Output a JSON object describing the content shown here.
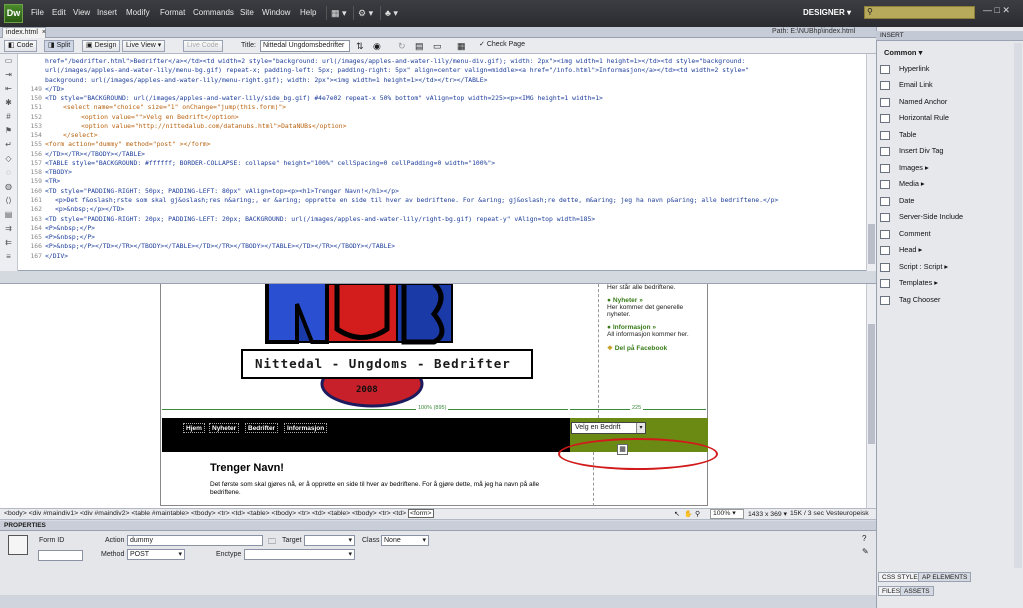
{
  "app": {
    "logo": "Dw",
    "workspace": "DESIGNER",
    "window_controls": "—  □  ✕"
  },
  "menu": [
    "File",
    "Edit",
    "View",
    "Insert",
    "Modify",
    "Format",
    "Commands",
    "Site",
    "Window",
    "Help"
  ],
  "document": {
    "tab": "index.html",
    "path_label": "Path:",
    "path": "E:\\NUBhp\\index.html"
  },
  "toolbar": {
    "code": "Code",
    "split": "Split",
    "design": "Design",
    "live_view": "Live View",
    "live_code": "Live Code",
    "title_label": "Title:",
    "title_value": "Nittedal Ungdomsbedrifter",
    "check_page": "Check Page"
  },
  "code": {
    "line_numbers": [
      "",
      "",
      "",
      "149",
      "150",
      "151",
      "152",
      "153",
      "154",
      "155",
      "156",
      "157",
      "158",
      "159",
      "160",
      "161",
      "162",
      "163",
      "164",
      "165",
      "166",
      "167"
    ],
    "lines": [
      "href=\"/bedrifter.html\">Bedrifter</a></td><td width=2 style=\"background: url(/images/apples-and-water-lily/menu-div.gif); width: 2px\"><img width=1 height=1></td><td style=\"background:",
      "url(/images/apples-and-water-lily/menu-bg.gif) repeat-x; padding-left: 5px; padding-right: 5px\" align=center valign=middle><a href=\"/info.html\">Informasjon</a></td><td width=2 style=\"",
      "background: url(/images/apples-and-water-lily/menu-right.gif); width: 2px\"><img width=1 height=1></td></tr></TABLE>",
      "</TD>",
      "<TD style=\"BACKGROUND: url(/images/apples-and-water-lily/side_bg.gif) #4e7e02 repeat-x 50% bottom\" vAlign=top width=225><p><IMG height=1 width=1>",
      "<select name=\"choice\" size=\"1\" onChange=\"jump(this.form)\">",
      "<option value=\"\">Velg en Bedrift</option>",
      "<option value=\"http://nittedalub.com/datanubs.html\">DataNUBs</option>",
      "</select>",
      "<form action=\"dummy\" method=\"post\" ></form>",
      "</TD></TR></TBODY></TABLE>",
      "<TABLE style=\"BACKGROUND: #ffffff; BORDER-COLLAPSE: collapse\" height=\"100%\" cellSpacing=0 cellPadding=0 width=\"100%\">",
      "<TBODY>",
      "<TR>",
      "<TD style=\"PADDING-RIGHT: 50px; PADDING-LEFT: 80px\" vAlign=top><p><h1>Trenger Navn!</h1></p>",
      "<p>Det f&oslash;rste som skal gj&oslash;res n&aring;, er &aring; opprette en side til hver av bedriftene. For &aring; gj&oslash;re dette, m&aring; jeg ha navn p&aring; alle bedriftene.</p>",
      "<p>&nbsp;</p></TD>",
      "<TD style=\"PADDING-RIGHT: 20px; PADDING-LEFT: 20px; BACKGROUND: url(/images/apples-and-water-lily/right-bg.gif) repeat-y\" vAlign=top width=185>",
      "<P>&nbsp;</P>",
      "<P>&nbsp;</P>",
      "<P>&nbsp;</P></TD></TR></TBODY></TABLE></TD></TR></TBODY></TABLE></TD></TR></TBODY></TABLE>",
      "</DIV>"
    ]
  },
  "design": {
    "logo_caption": "Nittedal - Ungdoms - Bedrifter",
    "logo_year": "2008",
    "sidebar": [
      {
        "head": "",
        "text": "Her står alle bedriftene."
      },
      {
        "head": "● Nyheter »",
        "text": "Her kommer det generelle nyheter."
      },
      {
        "head": "● Informasjon »",
        "text": "All informasjon kommer her."
      }
    ],
    "facebook": "Del på Facebook",
    "width_left": "100% (895)",
    "width_right": "225",
    "nav": [
      "Hjem",
      "Nyheter",
      "Bedrifter",
      "Informasjon"
    ],
    "select_value": "Velg en Bedrift",
    "heading": "Trenger Navn!",
    "body": "Det første som skal gjøres nå, er å opprette en side til hver av bedriftene. For å gjøre dette, må jeg ha navn på alle bedriftene."
  },
  "status": {
    "tagpath": "<body> <div #maindiv1> <div #maindiv2> <table #maintable> <tbody> <tr> <td> <table> <tbody> <tr> <td> <table> <tbody> <tr> <td>",
    "selected_tag": "<form>",
    "zoom": "100%",
    "dimensions": "1433 x 369 ▾",
    "size_time": "15K / 3 sec",
    "encoding": "Vesteuropeisk"
  },
  "properties": {
    "header": "PROPERTIES",
    "form_id_label": "Form ID",
    "form_id_value": "",
    "action_label": "Action",
    "action_value": "dummy",
    "target_label": "Target",
    "target_value": "",
    "class_label": "Class",
    "class_value": "None",
    "method_label": "Method",
    "method_value": "POST",
    "enctype_label": "Enctype",
    "enctype_value": ""
  },
  "insert_panel": {
    "header": "INSERT",
    "category": "Common",
    "items": [
      "Hyperlink",
      "Email Link",
      "Named Anchor",
      "Horizontal Rule",
      "Table",
      "Insert Div Tag",
      "Images",
      "Media",
      "Date",
      "Server-Side Include",
      "Comment",
      "Head",
      "Script : Script",
      "Templates",
      "Tag Chooser"
    ]
  },
  "panel_tabs": {
    "css": "CSS STYLES",
    "ap": "AP ELEMENTS",
    "files": "FILES",
    "assets": "ASSETS"
  },
  "colors": {
    "menubar": "#2f3135",
    "nav_bg": "#000000",
    "side_green": "#6b8a14",
    "highlight_red": "#d21a1a",
    "search_bg": "#b8aa5b"
  }
}
